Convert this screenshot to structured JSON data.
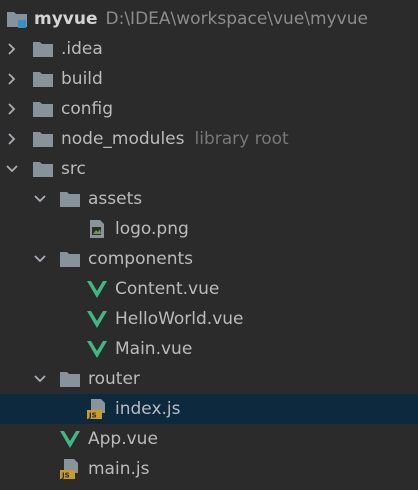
{
  "project": {
    "name": "myvue",
    "path": "D:\\IDEA\\workspace\\vue\\myvue"
  },
  "folders": {
    "idea": ".idea",
    "build": "build",
    "config": "config",
    "node_modules": "node_modules",
    "node_modules_hint": "library root",
    "src": "src",
    "assets": "assets",
    "components": "components",
    "router": "router"
  },
  "files": {
    "logo": "logo.png",
    "content_vue": "Content.vue",
    "helloworld_vue": "HelloWorld.vue",
    "main_vue": "Main.vue",
    "index_js": "index.js",
    "app_vue": "App.vue",
    "main_js": "main.js"
  },
  "colors": {
    "background": "#2b2b2b",
    "selection": "#0d293e",
    "folder": "#87939a",
    "vue_green": "#41b883",
    "js_badge": "#c99b2a"
  },
  "icons": {
    "folder": "folder-icon",
    "vue": "vue-file-icon",
    "js": "js-file-icon",
    "image": "image-file-icon",
    "module": "module-folder-icon"
  }
}
